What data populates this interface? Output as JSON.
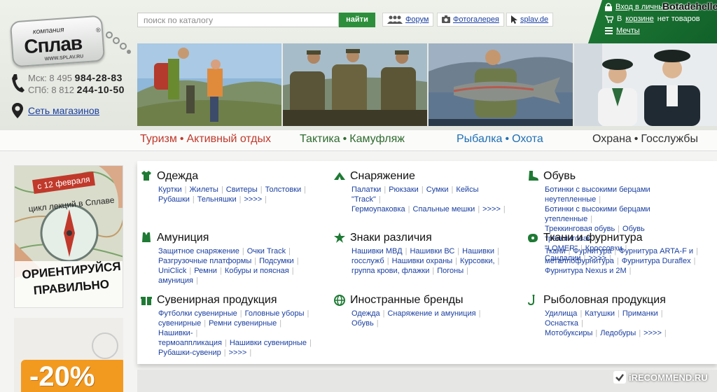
{
  "logo": {
    "small_text": "компания",
    "name": "Сплав",
    "url": "WWW.SPLAV.RU",
    "reg": "®"
  },
  "phones": [
    {
      "city": "Мск:",
      "prefix": "8 495",
      "number": "984-28-83"
    },
    {
      "city": "СПб:",
      "prefix": "8 812",
      "number": "244-10-50"
    }
  ],
  "stores_link": "Сеть магазинов",
  "search": {
    "placeholder": "поиск по каталогу",
    "button": "найти"
  },
  "top_links": [
    {
      "label": "Форум",
      "icon": "people-icon"
    },
    {
      "label": "Фотогалерея",
      "icon": "camera-icon"
    },
    {
      "label": "splav.de",
      "icon": "cursor-icon"
    }
  ],
  "account": {
    "login": "Вход в личный кабинет",
    "cart_prefix": "В",
    "cart_link": "корзине",
    "cart_suffix": "нет товаров",
    "dreams": "Мечты"
  },
  "watermark_top": "Botadehelle",
  "categories": [
    {
      "a": "Туризм",
      "b": "Активный отдых",
      "color": "#c0392b"
    },
    {
      "a": "Тактика",
      "b": "Камуфляж",
      "color": "#2f6b2f"
    },
    {
      "a": "Рыбалка",
      "b": "Охота",
      "color": "#1f6fb3"
    },
    {
      "a": "Охрана",
      "b": "Госслужбы",
      "color": "#333333"
    }
  ],
  "promo": {
    "date": "с 12 февраля",
    "line": "цикл лекций в Сплаве",
    "headline1": "ОРИЕНТИРУЙСЯ",
    "headline2": "ПРАВИЛЬНО"
  },
  "promo2": {
    "discount": "-20%"
  },
  "sections": [
    {
      "title": "Одежда",
      "icon": "shirt-icon",
      "lines": [
        [
          "Куртки",
          "Жилеты",
          "Свитеры",
          "Толстовки"
        ],
        [
          "Рубашки",
          "Тельняшки",
          ">>>>"
        ]
      ]
    },
    {
      "title": "Снаряжение",
      "icon": "tent-icon",
      "lines": [
        [
          "Палатки",
          "Рюкзаки",
          "Сумки",
          "Кейсы \"Track\""
        ],
        [
          "Гермоупаковка",
          "Спальные мешки",
          ">>>>"
        ]
      ]
    },
    {
      "title": "Обувь",
      "icon": "boot-icon",
      "lines": [
        [
          "Ботинки с высокими берцами неутепленные"
        ],
        [
          "Ботинки с высокими берцами утепленные"
        ],
        [
          "Треккинговая обувь",
          "Обувь треккинговая"
        ],
        [
          "\"LOMER\"",
          "Кроссовки",
          "Сандалии",
          ">>>>"
        ]
      ]
    },
    {
      "title": "Амуниция",
      "icon": "vest-icon",
      "lines": [
        [
          "Защитное снаряжение",
          "Очки Track"
        ],
        [
          "Разгрузочные платформы",
          "Подсумки"
        ],
        [
          "UniClick",
          "Ремни",
          "Кобуры и поясная"
        ],
        [
          "амуниция"
        ]
      ]
    },
    {
      "title": "Знаки различия",
      "icon": "star-icon",
      "lines": [
        [
          "Нашивки МВД",
          "Нашивки ВС",
          "Нашивки"
        ],
        [
          "госслужб",
          "Нашивки охраны",
          "Курсовки,"
        ],
        [
          "группа крови, флажки",
          "Погоны"
        ]
      ]
    },
    {
      "title": "Ткани и фурнитура",
      "icon": "fabric-icon",
      "lines": [
        [
          "Ткани",
          "Фурнитура",
          "Фурнитура ARTA-F и"
        ],
        [
          "металлофурнитура",
          "Фурнитура Duraflex"
        ],
        [
          "Фурнитура Nexus и 2M"
        ]
      ]
    },
    {
      "title": "Сувенирная продукция",
      "icon": "gift-icon",
      "lines": [
        [
          "Футболки сувенирные",
          "Головные уборы"
        ],
        [
          "сувенирные",
          "Ремни сувенирные",
          "Нашивки-"
        ],
        [
          "термоаппликация",
          "Нашивки сувенирные"
        ],
        [
          "Рубашки-сувенир",
          ">>>>"
        ]
      ]
    },
    {
      "title": "Иностранные бренды",
      "icon": "globe-icon",
      "lines": [
        [
          "Одежда",
          "Снаряжение и амуниция",
          "Обувь"
        ]
      ]
    },
    {
      "title": "Рыболовная продукция",
      "icon": "hook-icon",
      "lines": [
        [
          "Удилища",
          "Катушки",
          "Приманки",
          "Оснастка"
        ],
        [
          "Мотобуксиры",
          "Ледобуры",
          ">>>>"
        ]
      ]
    }
  ],
  "recommend": "iRECOMMEND.RU"
}
